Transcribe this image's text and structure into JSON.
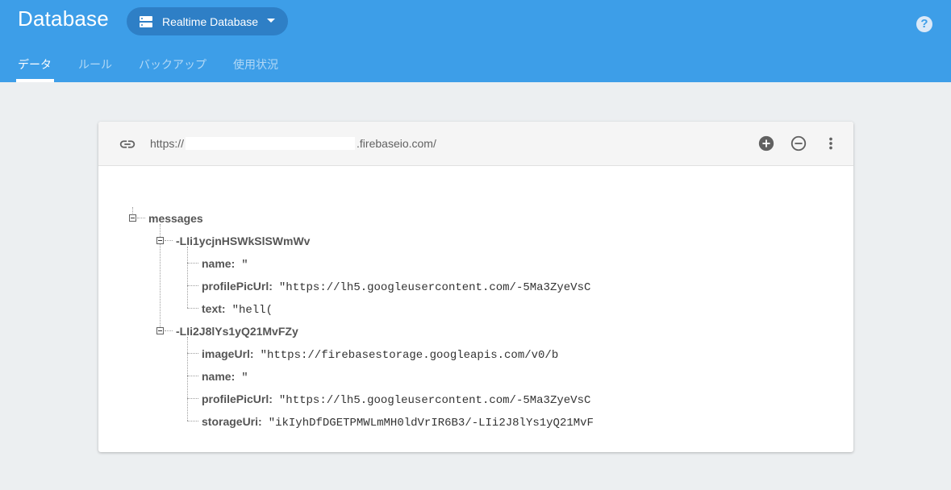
{
  "header": {
    "title": "Database",
    "db_selector": "Realtime Database",
    "help": "?"
  },
  "tabs": [
    {
      "label": "データ",
      "active": true
    },
    {
      "label": "ルール",
      "active": false
    },
    {
      "label": "バックアップ",
      "active": false
    },
    {
      "label": "使用状況",
      "active": false
    }
  ],
  "card": {
    "url_prefix": "https://",
    "url_suffix": ".firebaseio.com/",
    "icons": [
      "link-icon",
      "add-circle-icon",
      "remove-circle-icon",
      "more-vert-icon"
    ]
  },
  "tree": {
    "root": "messages",
    "children": [
      {
        "key": "-LIi1ycjnHSWkSlSWmWv",
        "fields": [
          {
            "key": "name:",
            "value": "\""
          },
          {
            "key": "profilePicUrl:",
            "value": "\"https://lh5.googleusercontent.com/-5Ma3ZyeVsC"
          },
          {
            "key": "text:",
            "value": "\"hell("
          }
        ]
      },
      {
        "key": "-LIi2J8lYs1yQ21MvFZy",
        "fields": [
          {
            "key": "imageUrl:",
            "value": "\"https://firebasestorage.googleapis.com/v0/b"
          },
          {
            "key": "name:",
            "value": "\""
          },
          {
            "key": "profilePicUrl:",
            "value": "\"https://lh5.googleusercontent.com/-5Ma3ZyeVsC"
          },
          {
            "key": "storageUri:",
            "value": "\"ikIyhDfDGETPMWLmMH0ldVrIR6B3/-LIi2J8lYs1yQ21MvF"
          }
        ]
      }
    ]
  },
  "colors": {
    "header": "#3d9ee8",
    "background": "#eceff1",
    "card": "#ffffff"
  }
}
